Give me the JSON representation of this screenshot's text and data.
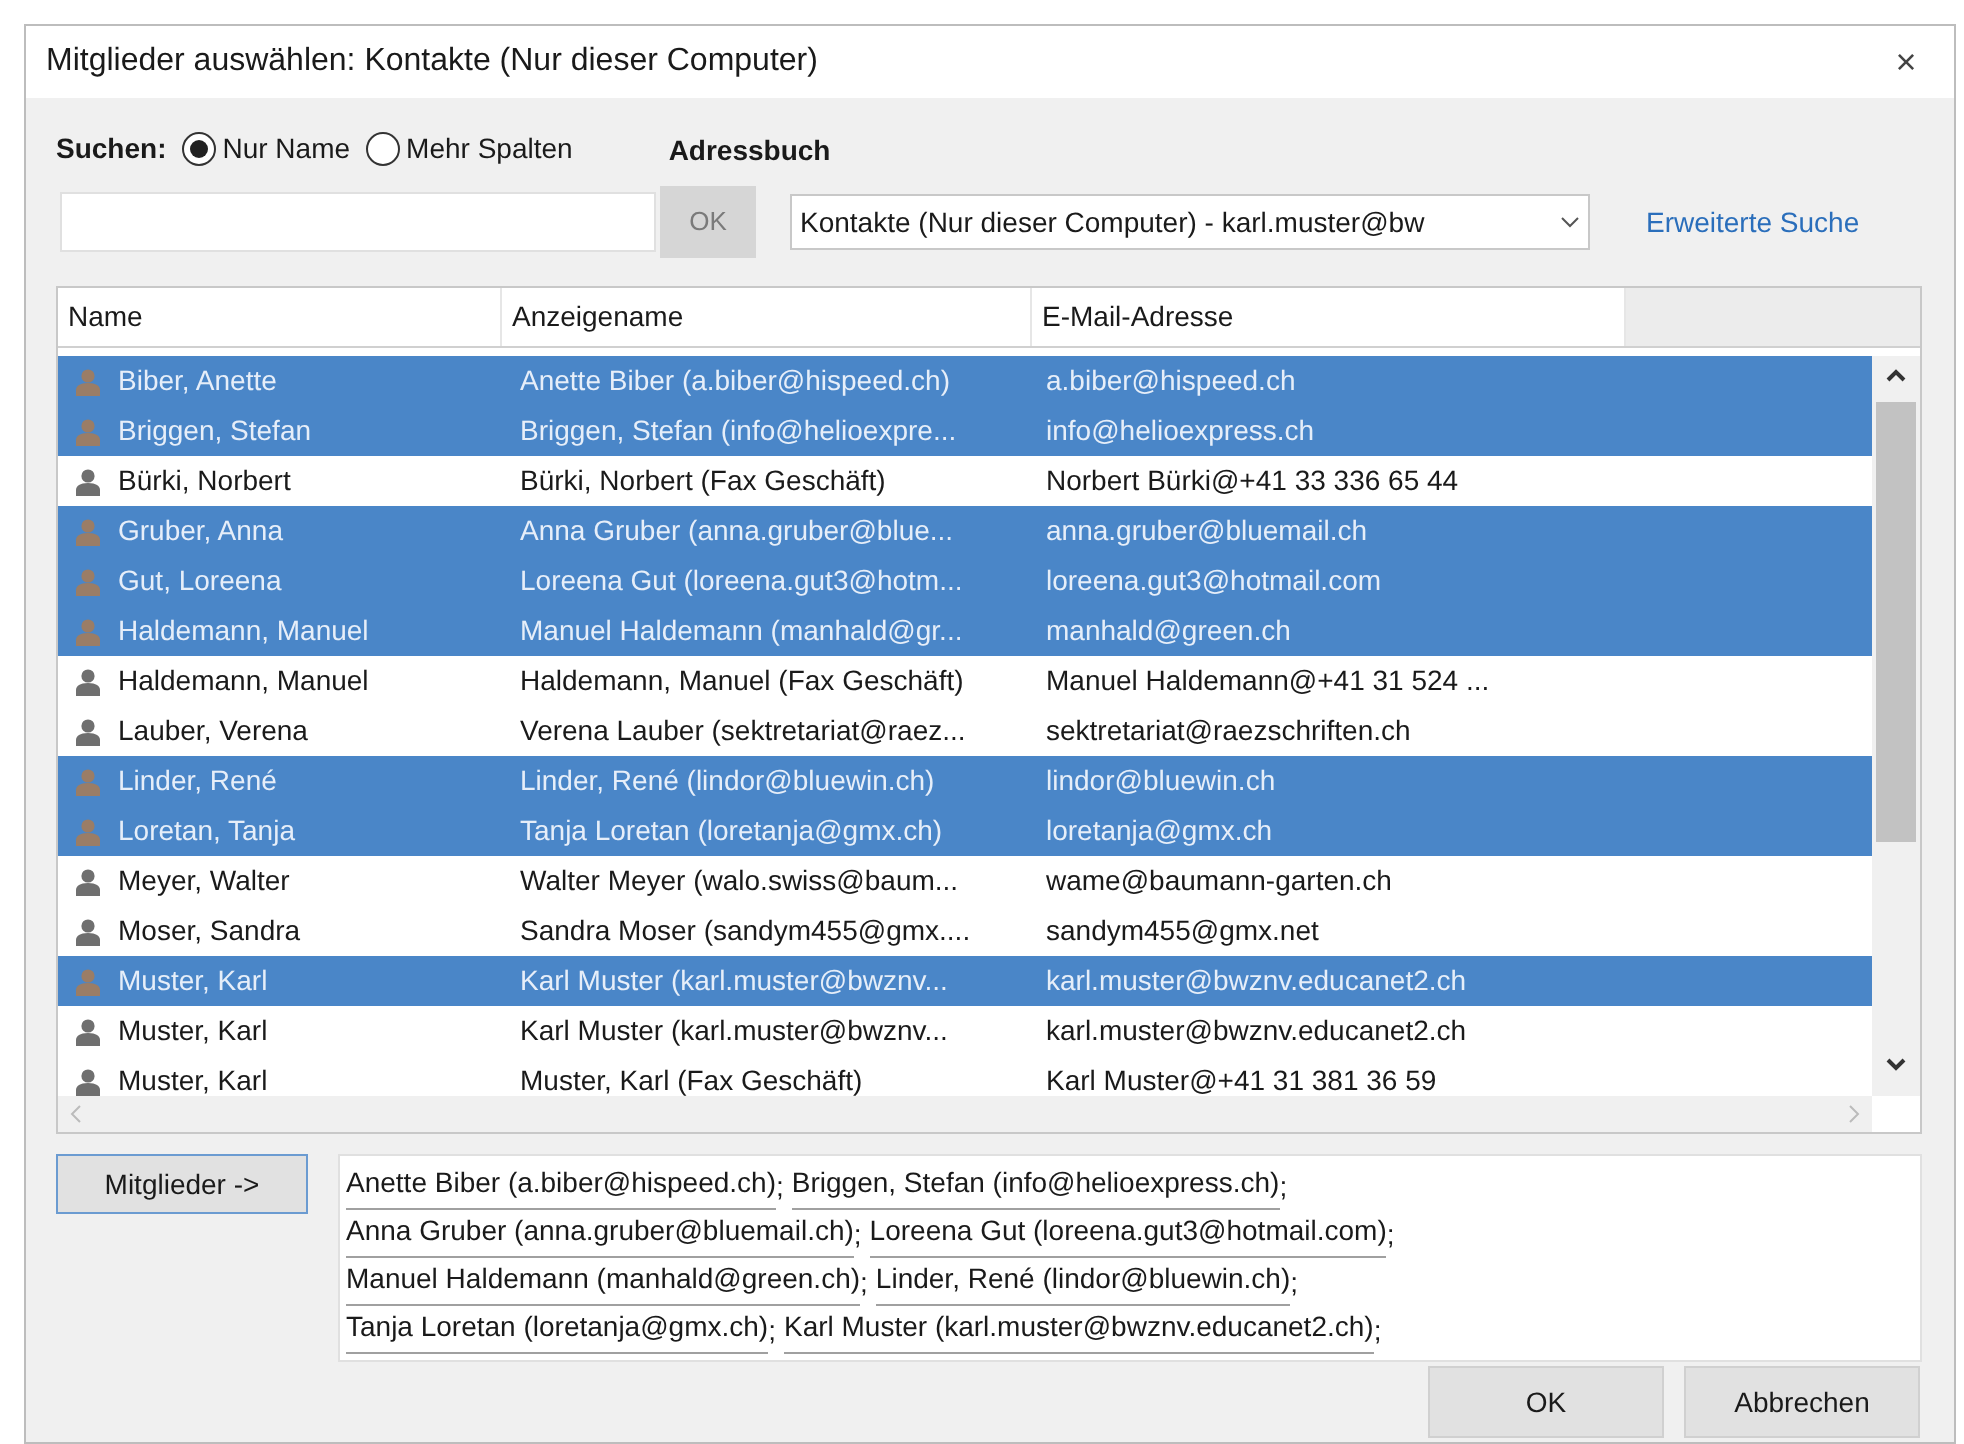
{
  "window": {
    "title": "Mitglieder auswählen: Kontakte (Nur dieser Computer)",
    "close": "×"
  },
  "search": {
    "label": "Suchen:",
    "options": [
      {
        "label": "Nur Name",
        "selected": true
      },
      {
        "label": "Mehr Spalten",
        "selected": false
      }
    ],
    "ok_button": {
      "label": "OK",
      "disabled": true
    }
  },
  "address_book": {
    "label": "Adressbuch",
    "value": "Kontakte (Nur dieser Computer) - karl.muster@bw"
  },
  "advanced_search": "Erweiterte Suche",
  "table": {
    "columns": [
      "Name",
      "Anzeigename",
      "E-Mail-Adresse"
    ],
    "rows": [
      {
        "name": "Biber, Anette",
        "display": "Anette Biber (a.biber@hispeed.ch)",
        "email": "a.biber@hispeed.ch",
        "selected": true
      },
      {
        "name": "Briggen, Stefan",
        "display": "Briggen, Stefan (info@helioexpre...",
        "email": "info@helioexpress.ch",
        "selected": true
      },
      {
        "name": "Bürki, Norbert",
        "display": "Bürki, Norbert (Fax Geschäft)",
        "email": "Norbert Bürki@+41 33 336 65 44",
        "selected": false
      },
      {
        "name": "Gruber, Anna",
        "display": "Anna Gruber (anna.gruber@blue...",
        "email": "anna.gruber@bluemail.ch",
        "selected": true
      },
      {
        "name": "Gut, Loreena",
        "display": "Loreena Gut (loreena.gut3@hotm...",
        "email": "loreena.gut3@hotmail.com",
        "selected": true
      },
      {
        "name": "Haldemann, Manuel",
        "display": "Manuel Haldemann (manhald@gr...",
        "email": "manhald@green.ch",
        "selected": true
      },
      {
        "name": "Haldemann, Manuel",
        "display": "Haldemann, Manuel (Fax Geschäft)",
        "email": "Manuel Haldemann@+41 31 524 ...",
        "selected": false
      },
      {
        "name": "Lauber, Verena",
        "display": "Verena Lauber (sektretariat@raez...",
        "email": "sektretariat@raezschriften.ch",
        "selected": false
      },
      {
        "name": "Linder, René",
        "display": "Linder, René (lindor@bluewin.ch)",
        "email": "lindor@bluewin.ch",
        "selected": true
      },
      {
        "name": "Loretan, Tanja",
        "display": "Tanja Loretan (loretanja@gmx.ch)",
        "email": "loretanja@gmx.ch",
        "selected": true
      },
      {
        "name": "Meyer, Walter",
        "display": "Walter Meyer (walo.swiss@baum...",
        "email": "wame@baumann-garten.ch",
        "selected": false
      },
      {
        "name": "Moser, Sandra",
        "display": "Sandra Moser (sandym455@gmx....",
        "email": "sandym455@gmx.net",
        "selected": false
      },
      {
        "name": "Muster, Karl",
        "display": "Karl Muster (karl.muster@bwznv...",
        "email": "karl.muster@bwznv.educanet2.ch",
        "selected": true
      },
      {
        "name": "Muster, Karl",
        "display": "Karl Muster (karl.muster@bwznv...",
        "email": "karl.muster@bwznv.educanet2.ch",
        "selected": false
      },
      {
        "name": "Muster, Karl",
        "display": "Muster, Karl (Fax Geschäft)",
        "email": "Karl Muster@+41 31 381 36 59",
        "selected": false
      }
    ]
  },
  "members_button": "Mitglieder ->",
  "members": {
    "separator": ";",
    "lines": [
      [
        "Anette Biber (a.biber@hispeed.ch)",
        "Briggen, Stefan (info@helioexpress.ch)"
      ],
      [
        "Anna Gruber (anna.gruber@bluemail.ch)",
        "Loreena Gut (loreena.gut3@hotmail.com)"
      ],
      [
        "Manuel Haldemann (manhald@green.ch)",
        "Linder, René (lindor@bluewin.ch)"
      ],
      [
        "Tanja Loretan (loretanja@gmx.ch)",
        "Karl Muster (karl.muster@bwznv.educanet2.ch)"
      ]
    ]
  },
  "buttons": [
    "OK",
    "Abbrechen"
  ]
}
